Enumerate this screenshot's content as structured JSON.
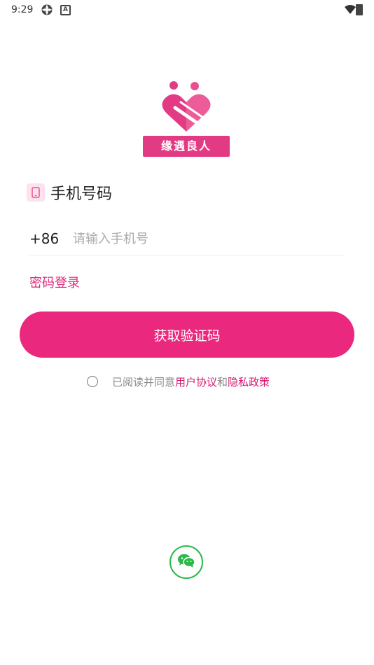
{
  "status_bar": {
    "time": "9:29",
    "icons": [
      "settings-icon",
      "a-icon",
      "wifi-icon",
      "battery-icon"
    ],
    "a_letter": "A"
  },
  "logo": {
    "text": "缘遇良人",
    "color": "#e23b84"
  },
  "phone_section": {
    "label": "手机号码",
    "country_code": "+86",
    "placeholder": "请输入手机号"
  },
  "password_login": {
    "label": "密码登录"
  },
  "get_code_button": {
    "label": "获取验证码",
    "color": "#ea287e"
  },
  "agreement": {
    "prefix": "已阅读并同意",
    "user_agreement": "用户协议",
    "and": "和",
    "privacy_policy": "隐私政策",
    "checked": false
  },
  "wechat_login": {
    "icon": "wechat-icon",
    "color": "#2ab947"
  }
}
